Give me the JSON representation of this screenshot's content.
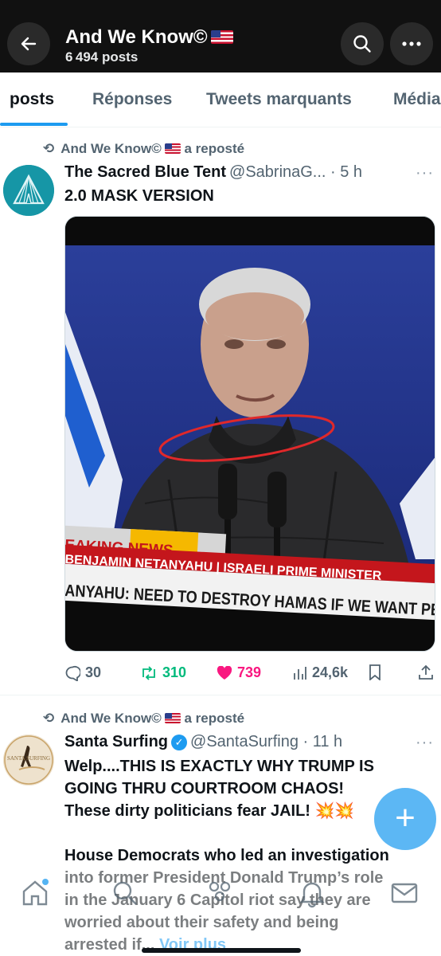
{
  "header": {
    "title": "And We Know©",
    "posts_count": "6 494 posts"
  },
  "tabs": [
    {
      "label": "posts",
      "active": true
    },
    {
      "label": "Réponses",
      "active": false
    },
    {
      "label": "Tweets marquants",
      "active": false
    },
    {
      "label": "Média",
      "active": false
    }
  ],
  "posts": [
    {
      "repost_label": "And We Know©",
      "repost_suffix": "a reposté",
      "author_name": "The Sacred Blue Tent",
      "handle_time": "@SabrinaG... · 5 h",
      "text": "2.0 MASK VERSION",
      "media": {
        "ticker_badge": "EAKING NEWS",
        "ticker_name": "BENJAMIN NETANYAHU | ISRAELI PRIME MINISTER",
        "ticker_headline": "ANYAHU: NEED TO DESTROY HAMAS IF WE WANT PEACE"
      },
      "stats": {
        "replies": "30",
        "reposts": "310",
        "likes": "739",
        "views": "24,6k"
      }
    },
    {
      "repost_label": "And We Know©",
      "repost_suffix": "a reposté",
      "author_name": "Santa Surfing",
      "handle_time": "@SantaSurfing · 11 h",
      "avatar_text": "SANTA SURFING",
      "text_lines": [
        "Welp....THIS IS EXACTLY WHY TRUMP IS",
        "GOING THRU COURTROOM CHAOS!",
        "These dirty politicians fear JAIL! 💥💥",
        "",
        "House Democrats who led an investigation",
        "into former President Donald Trump’s role",
        "in the January 6 Capitol riot say they are",
        "worried about their safety and being",
        "arrested if..."
      ],
      "see_more": "Voir plus"
    }
  ],
  "colors": {
    "accent": "#1d9bf0",
    "retweet_green": "#00ba7c",
    "like_pink": "#f91880",
    "text_secondary": "#536471"
  }
}
